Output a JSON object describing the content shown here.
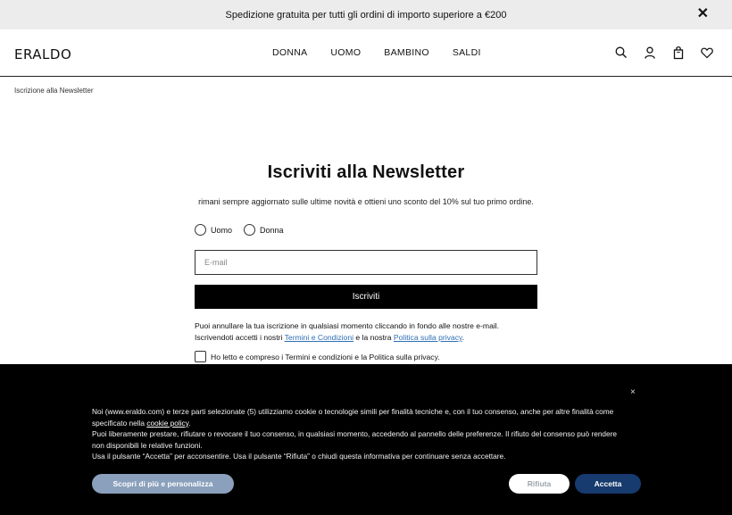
{
  "announcement": {
    "text": "Spedizione gratuita per tutti gli ordini di importo superiore a €200",
    "close_icon": "close-icon"
  },
  "header": {
    "logo": "ERALDO",
    "nav": [
      "DONNA",
      "UOMO",
      "BAMBINO",
      "SALDI"
    ],
    "icons": [
      "search-icon",
      "user-icon",
      "bag-icon",
      "heart-icon"
    ]
  },
  "breadcrumb": "Iscrizione alla Newsletter",
  "newsletter": {
    "title": "Iscriviti alla Newsletter",
    "subtitle": "rimani sempre aggiornato sulle ultime novità e ottieni uno sconto del 10% sul tuo primo ordine.",
    "gender_options": [
      "Uomo",
      "Donna"
    ],
    "email_placeholder": "E-mail",
    "email_value": "",
    "submit_label": "Iscriviti",
    "notice_line1": "Puoi annullare la tua iscrizione in qualsiasi momento cliccando in fondo alle nostre e-mail.",
    "notice_prefix": "Iscrivendoti accetti i nostri ",
    "terms_link": "Termini e Condizioni",
    "notice_middle": " e la nostra ",
    "privacy_link": "Politica sulla privacy",
    "notice_suffix": ".",
    "consent_label": "Ho letto e compreso i Termini e condizioni e la Politica sulla privacy."
  },
  "cookie_banner": {
    "close": "×",
    "text_prefix": "Noi (www.eraldo.com) e terze parti selezionate (5) utilizziamo cookie o tecnologie simili per finalità tecniche e, con il tuo consenso, anche per altre finalità come specificato nella ",
    "cookie_policy_link": "cookie policy",
    "text_suffix": ".",
    "text_line2": "Puoi liberamente prestare, rifiutare o revocare il tuo consenso, in qualsiasi momento, accedendo al pannello delle preferenze. Il rifiuto del consenso può rendere non disponibili le relative funzioni.",
    "text_line3": "Usa il pulsante “Accetta” per acconsentire. Usa il pulsante “Rifiuta” o chiudi questa informativa per continuare senza accettare.",
    "more_button": "Scopri di più e personalizza",
    "reject_button": "Rifiuta",
    "accept_button": "Accetta"
  }
}
